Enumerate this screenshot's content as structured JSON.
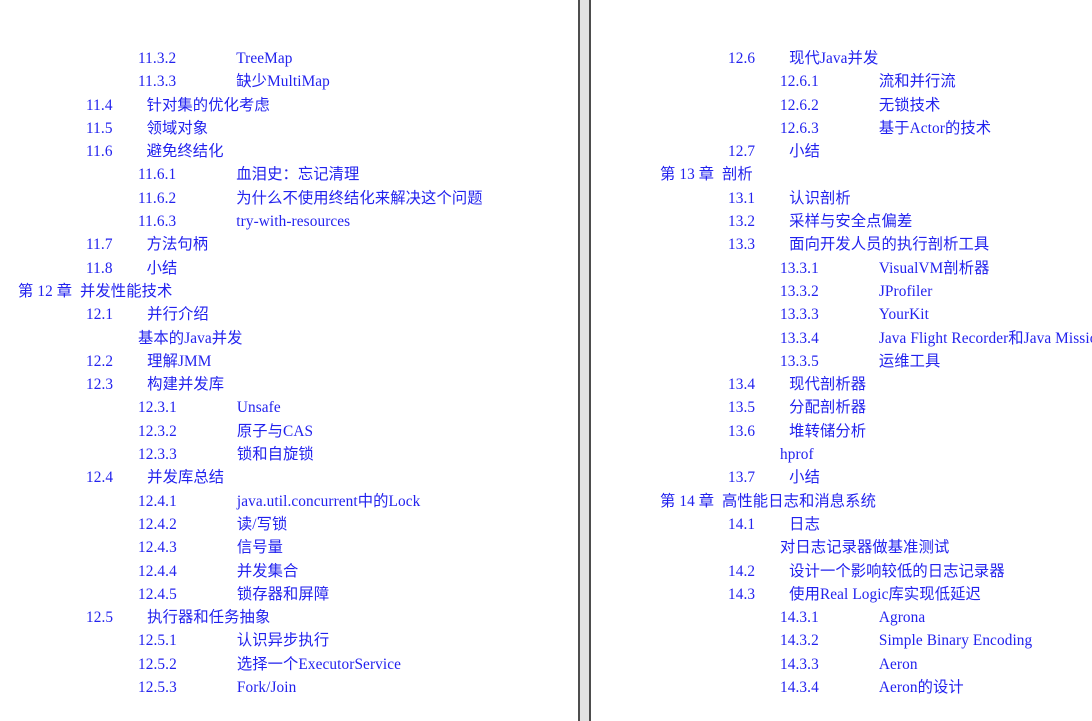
{
  "document": {
    "type": "table-of-contents",
    "language": "zh-CN",
    "text_color": "#2222ee",
    "background_color": "#ffffff",
    "divider_color": "#e2e2e2",
    "divider_border_color": "#4d4d4d"
  },
  "columns": [
    {
      "id": "left",
      "entries": [
        {
          "level": "level-3",
          "num": "11.3.2",
          "title": "TreeMap"
        },
        {
          "level": "level-3",
          "num": "11.3.3",
          "title": "缺少MultiMap"
        },
        {
          "level": "level-2",
          "num": "11.4",
          "title": "针对集的优化考虑"
        },
        {
          "level": "level-2",
          "num": "11.5",
          "title": "领域对象"
        },
        {
          "level": "level-2",
          "num": "11.6",
          "title": "避免终结化"
        },
        {
          "level": "level-3",
          "num": "11.6.1",
          "title": "血泪史：忘记清理"
        },
        {
          "level": "level-3",
          "num": "11.6.2",
          "title": "为什么不使用终结化来解决这个问题"
        },
        {
          "level": "level-3",
          "num": "11.6.3",
          "title": "try-with-resources"
        },
        {
          "level": "level-2",
          "num": "11.7",
          "title": "方法句柄"
        },
        {
          "level": "level-2",
          "num": "11.8",
          "title": "小结"
        },
        {
          "level": "level-chapter",
          "num": "第 12 章",
          "title": "并发性能技术"
        },
        {
          "level": "level-2",
          "num": "12.1",
          "title": "并行介绍"
        },
        {
          "level": "level-plain",
          "num": "",
          "title": "基本的Java并发"
        },
        {
          "level": "level-2",
          "num": "12.2",
          "title": "理解JMM"
        },
        {
          "level": "level-2",
          "num": "12.3",
          "title": "构建并发库"
        },
        {
          "level": "level-3",
          "num": "12.3.1",
          "title": "Unsafe"
        },
        {
          "level": "level-3",
          "num": "12.3.2",
          "title": "原子与CAS"
        },
        {
          "level": "level-3",
          "num": "12.3.3",
          "title": "锁和自旋锁"
        },
        {
          "level": "level-2",
          "num": "12.4",
          "title": "并发库总结"
        },
        {
          "level": "level-3",
          "num": "12.4.1",
          "title": "java.util.concurrent中的Lock"
        },
        {
          "level": "level-3",
          "num": "12.4.2",
          "title": "读/写锁"
        },
        {
          "level": "level-3",
          "num": "12.4.3",
          "title": "信号量"
        },
        {
          "level": "level-3",
          "num": "12.4.4",
          "title": "并发集合"
        },
        {
          "level": "level-3",
          "num": "12.4.5",
          "title": "锁存器和屏障"
        },
        {
          "level": "level-2",
          "num": "12.5",
          "title": "执行器和任务抽象"
        },
        {
          "level": "level-3",
          "num": "12.5.1",
          "title": "认识异步执行"
        },
        {
          "level": "level-3",
          "num": "12.5.2",
          "title": "选择一个ExecutorService"
        },
        {
          "level": "level-3",
          "num": "12.5.3",
          "title": "Fork/Join"
        }
      ]
    },
    {
      "id": "right",
      "entries": [
        {
          "level": "level-2",
          "num": "12.6",
          "title": "现代Java并发"
        },
        {
          "level": "level-3",
          "num": "12.6.1",
          "title": "流和并行流"
        },
        {
          "level": "level-3",
          "num": "12.6.2",
          "title": "无锁技术"
        },
        {
          "level": "level-3",
          "num": "12.6.3",
          "title": "基于Actor的技术"
        },
        {
          "level": "level-2",
          "num": "12.7",
          "title": "小结"
        },
        {
          "level": "level-chapter",
          "num": "第 13 章",
          "title": "剖析"
        },
        {
          "level": "level-2",
          "num": "13.1",
          "title": "认识剖析"
        },
        {
          "level": "level-2",
          "num": "13.2",
          "title": "采样与安全点偏差"
        },
        {
          "level": "level-2",
          "num": "13.3",
          "title": "面向开发人员的执行剖析工具"
        },
        {
          "level": "level-3",
          "num": "13.3.1",
          "title": "VisualVM剖析器"
        },
        {
          "level": "level-3",
          "num": "13.3.2",
          "title": "JProfiler"
        },
        {
          "level": "level-3",
          "num": "13.3.3",
          "title": "YourKit"
        },
        {
          "level": "level-3",
          "num": "13.3.4",
          "title": "Java Flight Recorder和Java Mission Control"
        },
        {
          "level": "level-3",
          "num": "13.3.5",
          "title": "运维工具"
        },
        {
          "level": "level-2",
          "num": "13.4",
          "title": "现代剖析器"
        },
        {
          "level": "level-2",
          "num": "13.5",
          "title": "分配剖析器"
        },
        {
          "level": "level-2",
          "num": "13.6",
          "title": "堆转储分析"
        },
        {
          "level": "level-plain",
          "num": "",
          "title": "hprof"
        },
        {
          "level": "level-2",
          "num": "13.7",
          "title": "小结"
        },
        {
          "level": "level-chapter",
          "num": "第 14 章",
          "title": "高性能日志和消息系统"
        },
        {
          "level": "level-2",
          "num": "14.1",
          "title": "日志"
        },
        {
          "level": "level-plain",
          "num": "",
          "title": "对日志记录器做基准测试"
        },
        {
          "level": "level-2",
          "num": "14.2",
          "title": "设计一个影响较低的日志记录器"
        },
        {
          "level": "level-2",
          "num": "14.3",
          "title": "使用Real Logic库实现低延迟"
        },
        {
          "level": "level-3",
          "num": "14.3.1",
          "title": "Agrona"
        },
        {
          "level": "level-3",
          "num": "14.3.2",
          "title": "Simple Binary Encoding"
        },
        {
          "level": "level-3",
          "num": "14.3.3",
          "title": "Aeron"
        },
        {
          "level": "level-3",
          "num": "14.3.4",
          "title": "Aeron的设计"
        }
      ]
    }
  ]
}
